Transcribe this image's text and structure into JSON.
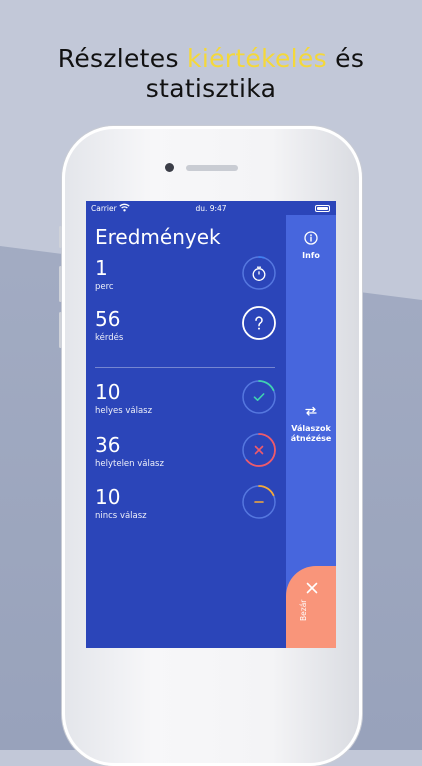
{
  "headline": {
    "part1": "Részletes ",
    "highlight": "kiértékelés",
    "part2": " és",
    "line2": "statisztika"
  },
  "status_bar": {
    "carrier": "Carrier",
    "time": "du. 9:47"
  },
  "results": {
    "title": "Eredmények",
    "stats": [
      {
        "value": "1",
        "label": "perc",
        "icon": "timer-icon",
        "progress": 0.05,
        "color": "#3f7ff0"
      },
      {
        "value": "56",
        "label": "kérdés",
        "icon": "question-icon",
        "progress": 1.0,
        "color": "#ffffff"
      },
      {
        "value": "10",
        "label": "helyes válasz",
        "icon": "check-icon",
        "progress": 0.18,
        "color": "#3fd3b0"
      },
      {
        "value": "36",
        "label": "helytelen válasz",
        "icon": "cross-icon",
        "progress": 0.64,
        "color": "#ef5a6a"
      },
      {
        "value": "10",
        "label": "nincs válasz",
        "icon": "minus-icon",
        "progress": 0.18,
        "color": "#f4a93a"
      }
    ]
  },
  "sidebar": {
    "info_label": "Info",
    "review_label_1": "Válaszok",
    "review_label_2": "átnézése",
    "close_label": "Bezár"
  },
  "colors": {
    "screen_bg": "#2b45b9",
    "rail_bg": "#4766dd",
    "close_bg": "#f9957a",
    "highlight": "#f4d83a"
  }
}
